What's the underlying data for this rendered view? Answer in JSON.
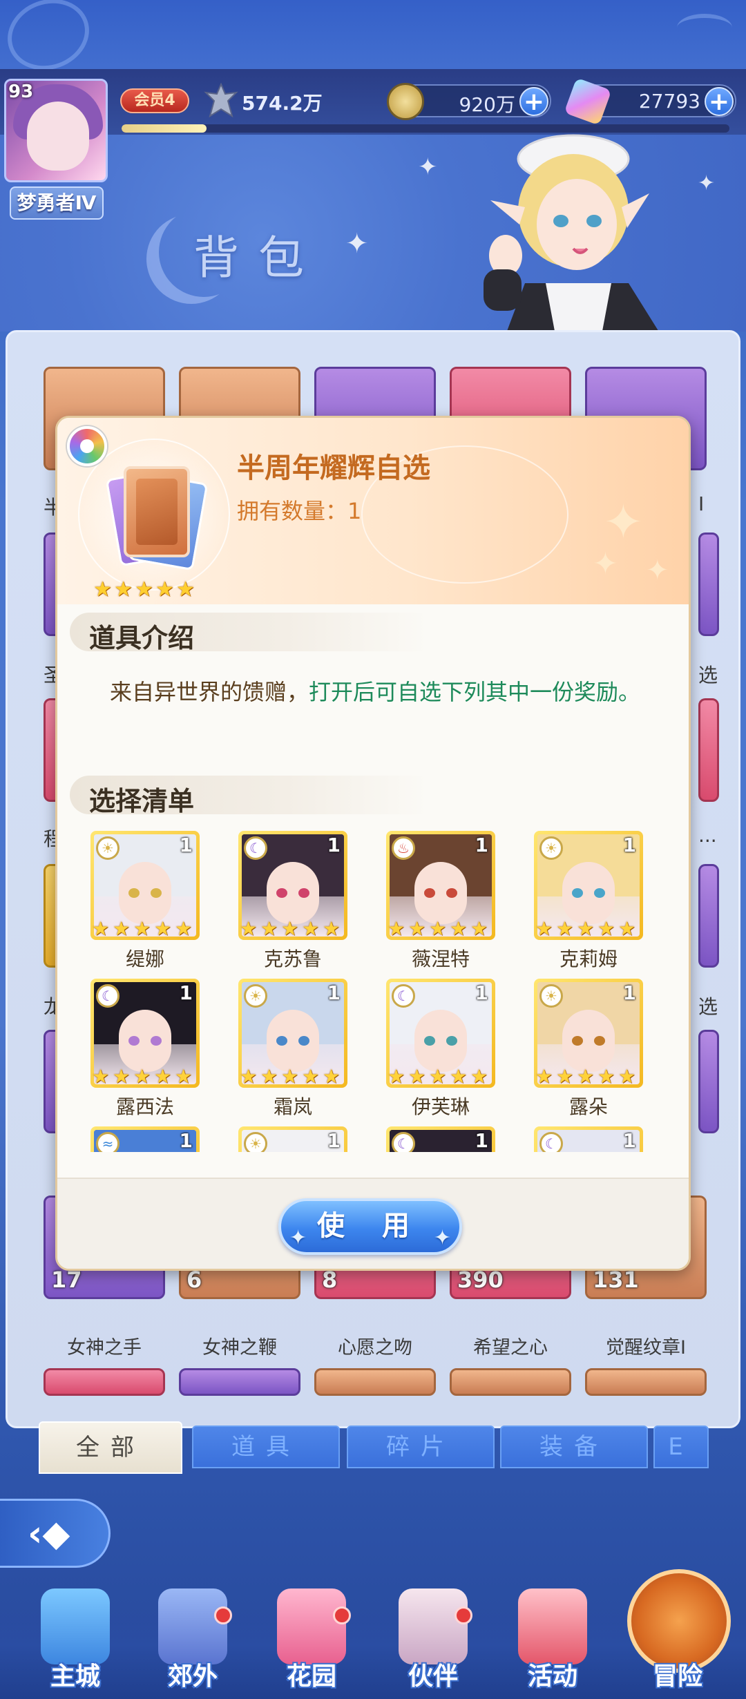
{
  "player": {
    "level": "93",
    "name": "梦勇者Ⅳ",
    "vip": "会员4",
    "power": "574.2万",
    "exp_fraction": 0.14
  },
  "currency": {
    "gold": "920万",
    "gems": "27793"
  },
  "page_title": "背包",
  "inventory_row_labels": {
    "row1_left": "半",
    "row1_right": "I",
    "row2_left": "圣",
    "row2_right": "选",
    "row3_left": "程",
    "row3_right": "...",
    "row4_left": "龙",
    "row4_right": "选"
  },
  "inventory_bottom": [
    {
      "count": "17",
      "label": "女神之手"
    },
    {
      "count": "6",
      "label": "女神之鞭"
    },
    {
      "count": "8",
      "label": "心愿之吻"
    },
    {
      "count": "390",
      "label": "希望之心"
    },
    {
      "count": "131",
      "label": "觉醒纹章Ⅰ"
    }
  ],
  "modal": {
    "item_name": "半周年耀辉自选",
    "owned_text": "拥有数量：1",
    "stars": 5,
    "section_intro": "道具介绍",
    "desc_plain": "来自异世界的馈赠，",
    "desc_highlight": "打开后可自选下列其中一份奖励。",
    "section_list": "选择清单",
    "use_button": "使 用",
    "rewards": [
      {
        "name": "缇娜",
        "qty": "1",
        "element": "sun",
        "hair": "#e9ecf2",
        "eye": "#d9b44a"
      },
      {
        "name": "克苏鲁",
        "qty": "1",
        "element": "moon",
        "hair": "#3a2c3c",
        "eye": "#d0436b"
      },
      {
        "name": "薇涅特",
        "qty": "1",
        "element": "fire",
        "hair": "#6b4430",
        "eye": "#c94a3a"
      },
      {
        "name": "克莉姆",
        "qty": "1",
        "element": "sun",
        "hair": "#f5dc98",
        "eye": "#4aa5c9"
      },
      {
        "name": "露西法",
        "qty": "1",
        "element": "moon",
        "hair": "#1e1a24",
        "eye": "#b07ad2"
      },
      {
        "name": "霜岚",
        "qty": "1",
        "element": "sun",
        "hair": "#c9d7ec",
        "eye": "#4a88c9"
      },
      {
        "name": "伊芙琳",
        "qty": "1",
        "element": "moon",
        "hair": "#eef0f6",
        "eye": "#4aa0a8"
      },
      {
        "name": "露朵",
        "qty": "1",
        "element": "sun",
        "hair": "#f0d6a6",
        "eye": "#c07b2a"
      },
      {
        "name": "",
        "qty": "1",
        "element": "water",
        "hair": "#4a7fd6",
        "eye": "#4a88c9"
      },
      {
        "name": "",
        "qty": "1",
        "element": "sun",
        "hair": "#f1f1f4",
        "eye": "#777"
      },
      {
        "name": "",
        "qty": "1",
        "element": "moon",
        "hair": "#2a2230",
        "eye": "#777"
      },
      {
        "name": "",
        "qty": "1",
        "element": "moon",
        "hair": "#e4e6f2",
        "eye": "#777"
      }
    ]
  },
  "tabs": [
    {
      "label": "全部",
      "active": true
    },
    {
      "label": "道具",
      "active": false
    },
    {
      "label": "碎片",
      "active": false
    },
    {
      "label": "装备",
      "active": false
    },
    {
      "label": "E",
      "active": false
    }
  ],
  "nav": [
    {
      "label": "主城",
      "dot": false
    },
    {
      "label": "郊外",
      "dot": true
    },
    {
      "label": "花园",
      "dot": true
    },
    {
      "label": "伙伴",
      "dot": true
    },
    {
      "label": "活动",
      "dot": false
    },
    {
      "label": "冒险",
      "dot": false
    }
  ],
  "colors": {
    "accent_orange": "#c46a20",
    "highlight_green": "#1d8a5a",
    "button_blue": "#3d86ee",
    "star_gold": "#ffcf30"
  }
}
